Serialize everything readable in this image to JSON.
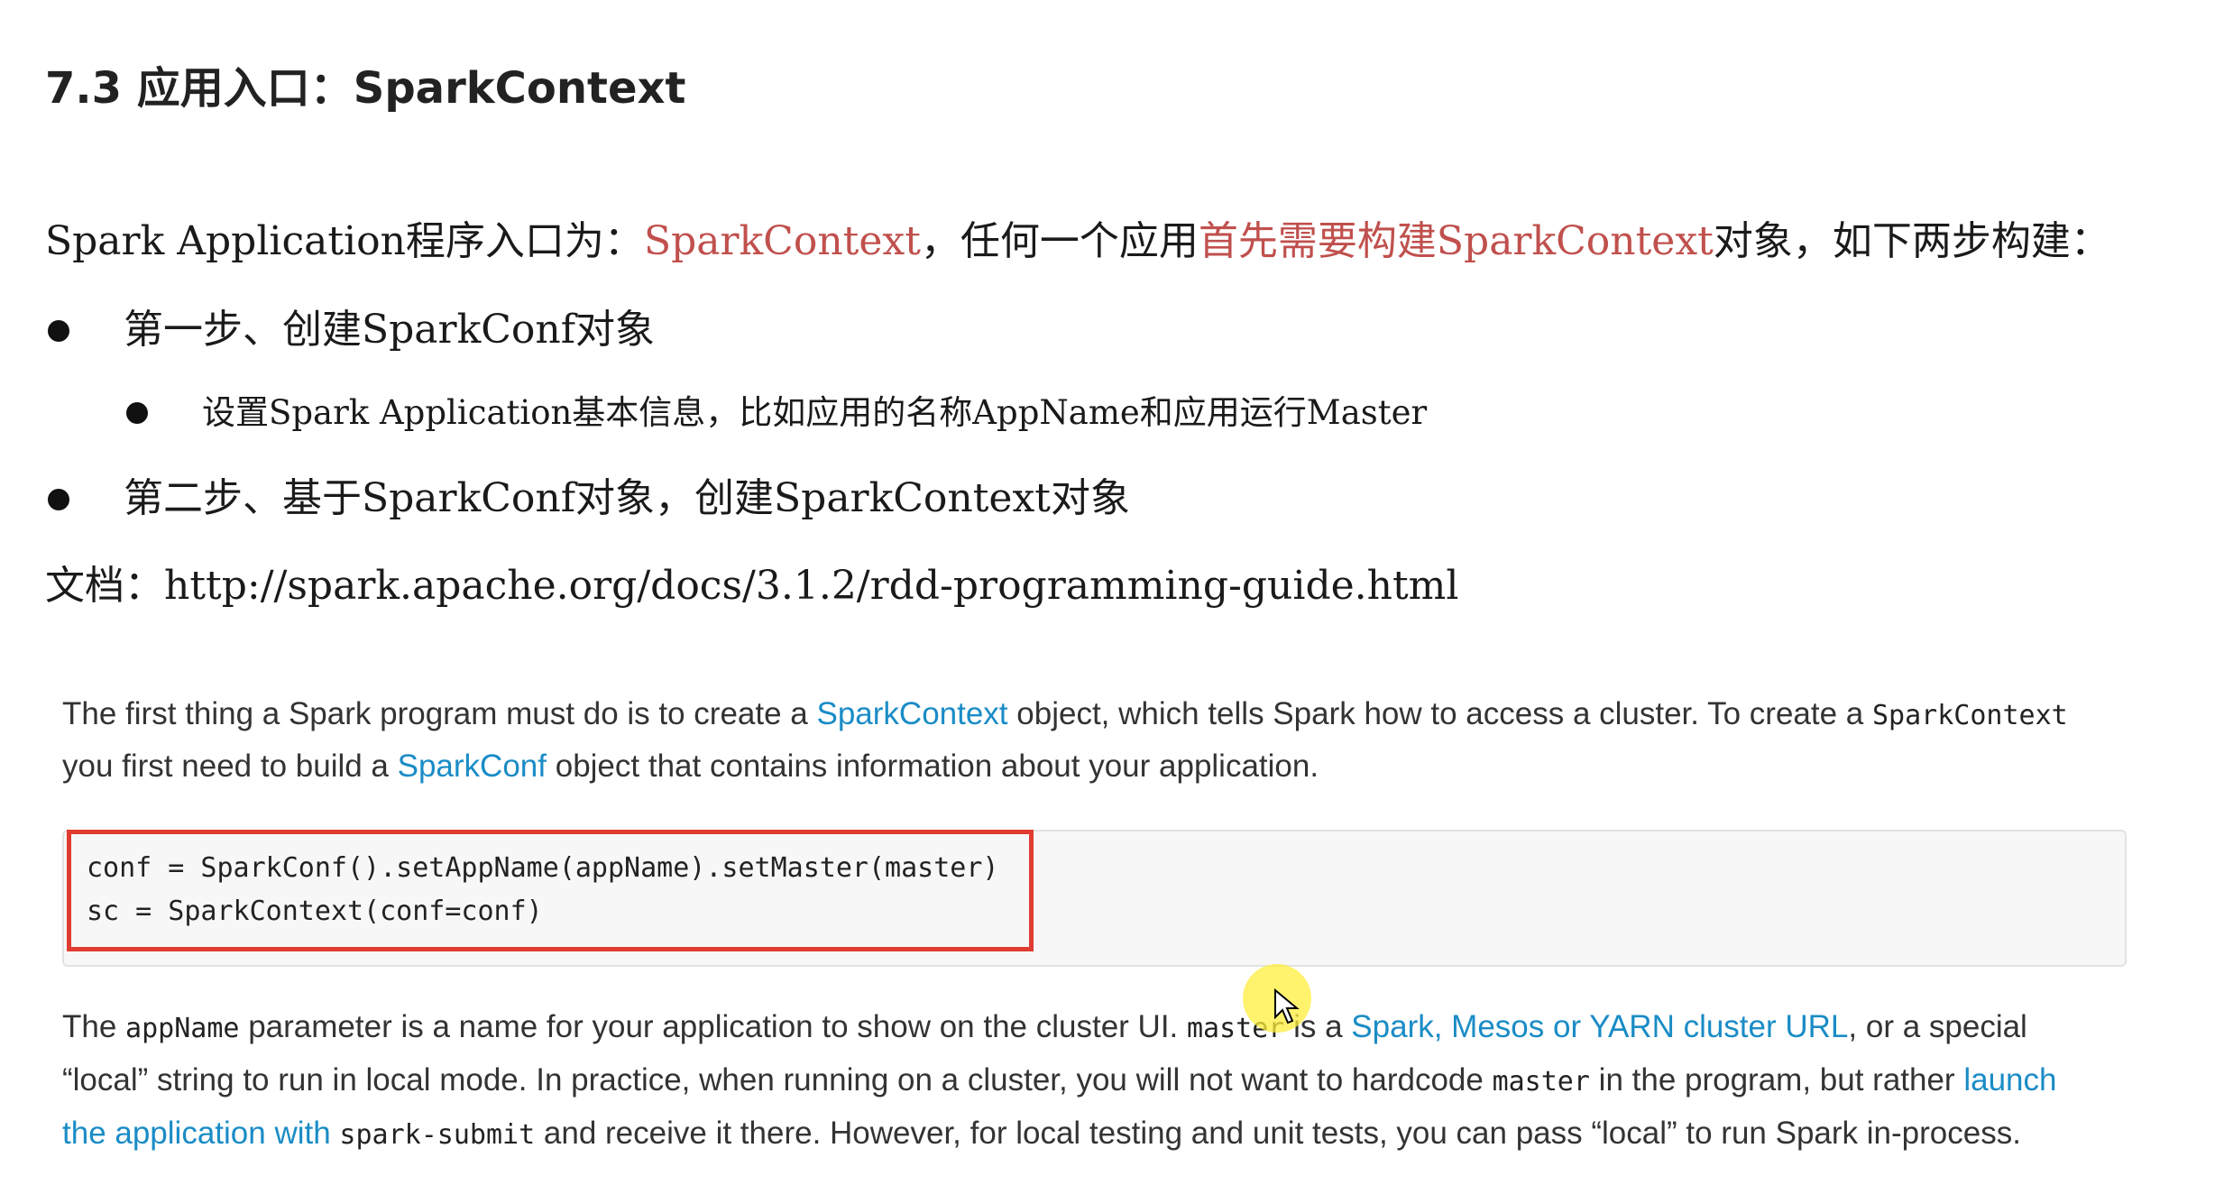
{
  "heading": "7.3 应用入口：SparkContext",
  "intro": {
    "prefix": "Spark Application程序入口为：",
    "entry": "SparkContext",
    "middle": "，任何一个应用",
    "highlight": "首先需要构建SparkContext",
    "suffix": "对象，如下两步构建："
  },
  "steps": [
    {
      "label": "第一步、创建SparkConf对象"
    },
    {
      "label": "设置Spark Application基本信息，比如应用的名称AppName和应用运行Master"
    },
    {
      "label": "第二步、基于SparkConf对象，创建SparkContext对象"
    }
  ],
  "doc_ref": {
    "label": "文档：",
    "url": "http://spark.apache.org/docs/3.1.2/rdd-programming-guide.html"
  },
  "para1": {
    "t1": "The first thing a Spark program must do is to create a ",
    "link1": "SparkContext",
    "t2": " object, which tells Spark how to access a cluster. To create a ",
    "code1": "SparkContext",
    "t3": "you first need to build a ",
    "link2": "SparkConf",
    "t4": " object that contains information about your application."
  },
  "code": {
    "line1": "conf = SparkConf().setAppName(appName).setMaster(master)",
    "line2": "sc = SparkContext(conf=conf)"
  },
  "para2": {
    "t1": "The ",
    "code1": "appName",
    "t2": " parameter is a name for your application to show on the cluster UI. ",
    "code2": "master",
    "t3": " is a ",
    "link1": "Spark, Mesos or YARN cluster URL",
    "t4": ", or a special",
    "t5": "“local” string to run in local mode. In practice, when running on a cluster, you will not want to hardcode ",
    "code3": "master",
    "t6": " in the program, but rather ",
    "link2": "launch",
    "link3a": "the application with ",
    "code4": "spark-submit",
    "t7": " and receive it there. However, for local testing and unit tests, you can pass “local” to run Spark in-process."
  },
  "colors": {
    "highlight_red": "#c0504d",
    "link_blue": "#1a8cc6",
    "box_red": "#e03c31",
    "cursor_yellow": "#ffee3c"
  },
  "icons": [
    "bullet-icon",
    "mouse-cursor-icon"
  ]
}
